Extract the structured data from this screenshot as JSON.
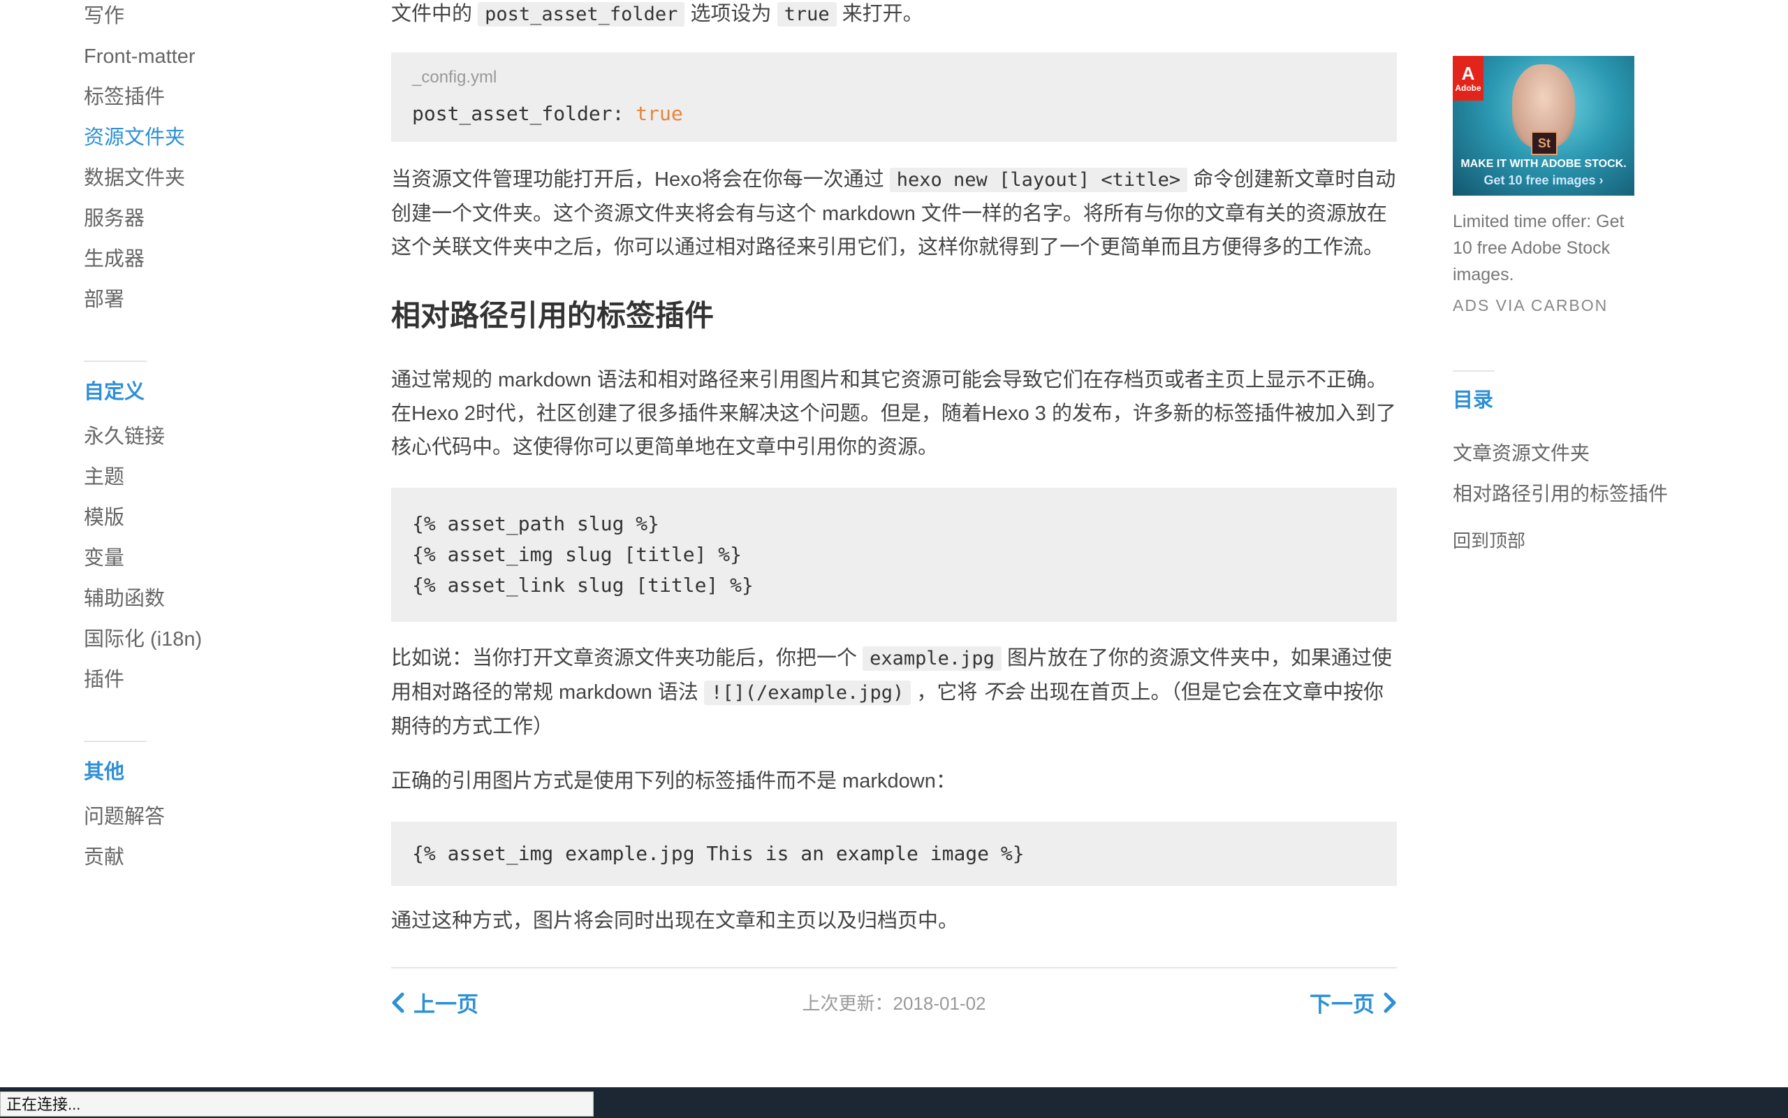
{
  "sidebar": {
    "top_items": [
      {
        "label": "写作"
      },
      {
        "label": "Front-matter"
      },
      {
        "label": "标签插件"
      },
      {
        "label": "资源文件夹"
      },
      {
        "label": "数据文件夹"
      },
      {
        "label": "服务器"
      },
      {
        "label": "生成器"
      },
      {
        "label": "部署"
      }
    ],
    "customize_title": "自定义",
    "customize_items": [
      {
        "label": "永久链接"
      },
      {
        "label": "主题"
      },
      {
        "label": "模版"
      },
      {
        "label": "变量"
      },
      {
        "label": "辅助函数"
      },
      {
        "label": "国际化 (i18n)"
      },
      {
        "label": "插件"
      }
    ],
    "other_title": "其他",
    "other_items": [
      {
        "label": "问题解答"
      },
      {
        "label": "贡献"
      }
    ]
  },
  "article": {
    "p0_a": "文件中的",
    "p0_code1": "post_asset_folder",
    "p0_b": "选项设为",
    "p0_code2": "true",
    "p0_c": "来打开。",
    "code1_caption": "_config.yml",
    "code1_key": "post_asset_folder: ",
    "code1_value": "true",
    "p1_a": "当资源文件管理功能打开后，Hexo将会在你每一次通过",
    "p1_code": "hexo new [layout] <title>",
    "p1_b": "命令创建新文章时自动创建一个文件夹。这个资源文件夹将会有与这个 markdown 文件一样的名字。将所有与你的文章有关的资源放在这个关联文件夹中之后，你可以通过相对路径来引用它们，这样你就得到了一个更简单而且方便得多的工作流。",
    "h2": "相对路径引用的标签插件",
    "p2": "通过常规的 markdown 语法和相对路径来引用图片和其它资源可能会导致它们在存档页或者主页上显示不正确。在Hexo 2时代，社区创建了很多插件来解决这个问题。但是，随着Hexo 3 的发布，许多新的标签插件被加入到了核心代码中。这使得你可以更简单地在文章中引用你的资源。",
    "code2": "{% asset_path slug %}\n{% asset_img slug [title] %}\n{% asset_link slug [title] %}",
    "p3_a": "比如说：当你打开文章资源文件夹功能后，你把一个",
    "p3_code1": "example.jpg",
    "p3_b": "图片放在了你的资源文件夹中，如果通过使用相对路径的常规 markdown 语法",
    "p3_code2": "![](/example.jpg)",
    "p3_c": "，它将",
    "p3_em": "不会",
    "p3_d": "出现在首页上。（但是它会在文章中按你期待的方式工作）",
    "p4": "正确的引用图片方式是使用下列的标签插件而不是 markdown：",
    "code3": "{% asset_img example.jpg This is an example image %}",
    "p5": "通过这种方式，图片将会同时出现在文章和主页以及归档页中。"
  },
  "footer_nav": {
    "prev": "上一页",
    "updated": "上次更新：2018-01-02",
    "next": "下一页"
  },
  "ad": {
    "logo_text": "Adobe",
    "product_badge": "St",
    "headline": "MAKE IT WITH ADOBE STOCK.",
    "cta": "Get 10 free images ›",
    "text": "Limited time offer: Get 10 free Adobe Stock images.",
    "via": "ADS VIA CARBON"
  },
  "toc": {
    "title": "目录",
    "items": [
      {
        "label": "文章资源文件夹"
      },
      {
        "label": "相对路径引用的标签插件"
      }
    ],
    "back_to_top": "回到顶部"
  },
  "statusbar": {
    "text": "正在连接..."
  },
  "colors": {
    "accent": "#2d8fd5",
    "code_bg": "#eeeeee",
    "keyword_true": "#e6853d",
    "status_bar": "#1c2733"
  }
}
